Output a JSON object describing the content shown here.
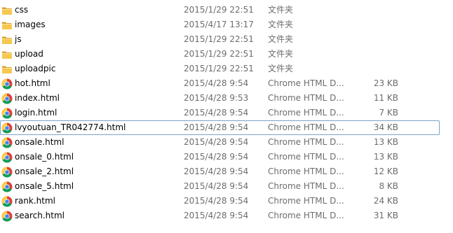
{
  "files": [
    {
      "name": "css",
      "date": "2015/1/29 22:51",
      "type": "文件夹",
      "size": "",
      "icon": "folder-icon"
    },
    {
      "name": "images",
      "date": "2015/4/17 13:17",
      "type": "文件夹",
      "size": "",
      "icon": "folder-icon"
    },
    {
      "name": "js",
      "date": "2015/1/29 22:51",
      "type": "文件夹",
      "size": "",
      "icon": "folder-icon"
    },
    {
      "name": "upload",
      "date": "2015/1/29 22:51",
      "type": "文件夹",
      "size": "",
      "icon": "folder-icon"
    },
    {
      "name": "uploadpic",
      "date": "2015/1/29 22:51",
      "type": "文件夹",
      "size": "",
      "icon": "folder-icon"
    },
    {
      "name": "hot.html",
      "date": "2015/4/28 9:54",
      "type": "Chrome HTML D...",
      "size": "23 KB",
      "icon": "chrome-icon"
    },
    {
      "name": "index.html",
      "date": "2015/4/28 9:53",
      "type": "Chrome HTML D...",
      "size": "11 KB",
      "icon": "chrome-icon"
    },
    {
      "name": "login.html",
      "date": "2015/4/28 9:54",
      "type": "Chrome HTML D...",
      "size": "7 KB",
      "icon": "chrome-icon"
    },
    {
      "name": "lvyoutuan_TR042774.html",
      "date": "2015/4/28 9:54",
      "type": "Chrome HTML D...",
      "size": "34 KB",
      "icon": "chrome-icon"
    },
    {
      "name": "onsale.html",
      "date": "2015/4/28 9:54",
      "type": "Chrome HTML D...",
      "size": "13 KB",
      "icon": "chrome-icon"
    },
    {
      "name": "onsale_0.html",
      "date": "2015/4/28 9:54",
      "type": "Chrome HTML D...",
      "size": "13 KB",
      "icon": "chrome-icon"
    },
    {
      "name": "onsale_2.html",
      "date": "2015/4/28 9:54",
      "type": "Chrome HTML D...",
      "size": "12 KB",
      "icon": "chrome-icon"
    },
    {
      "name": "onsale_5.html",
      "date": "2015/4/28 9:54",
      "type": "Chrome HTML D...",
      "size": "8 KB",
      "icon": "chrome-icon"
    },
    {
      "name": "rank.html",
      "date": "2015/4/28 9:54",
      "type": "Chrome HTML D...",
      "size": "24 KB",
      "icon": "chrome-icon"
    },
    {
      "name": "search.html",
      "date": "2015/4/28 9:54",
      "type": "Chrome HTML D...",
      "size": "31 KB",
      "icon": "chrome-icon"
    }
  ],
  "selected_file": "lvyoutuan_TR042774.html",
  "colors": {
    "selection_border": "#7da2ce",
    "folder_front": "#f6c84e",
    "folder_back": "#d9a22c",
    "secondary_text": "#6d6d6d"
  }
}
